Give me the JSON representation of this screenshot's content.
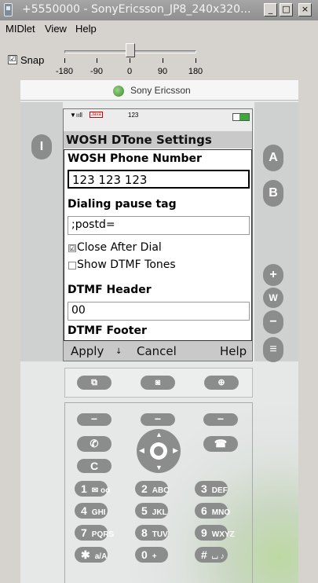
{
  "window": {
    "title": "+5550000 - SonyEricsson_JP8_240x320...",
    "min": "_",
    "max": "□",
    "close": "×"
  },
  "menu": {
    "items": [
      "MIDlet",
      "View",
      "Help"
    ]
  },
  "snap": {
    "label": "Snap",
    "checked": "☑",
    "ticks": [
      "-180",
      "-90",
      "0",
      "90",
      "180"
    ],
    "slider_value": 0
  },
  "phone": {
    "brand": "Sony Ericsson",
    "status": {
      "signal": "▼ııll",
      "java": "Java",
      "number": "123",
      "battery": "▮▮"
    },
    "screen_title": "WOSH DTone Settings",
    "form": {
      "phone_label": "WOSH Phone Number",
      "phone_value": "123 123 123",
      "pause_label": "Dialing pause tag",
      "pause_value": ";postd=",
      "close_label": "Close After Dial",
      "close_checked": "☑",
      "show_label": "Show DTMF Tones",
      "show_checked": "",
      "header_label": "DTMF Header",
      "header_value": "00",
      "footer_label": "DTMF Footer"
    },
    "softkeys": {
      "left": "Apply",
      "middle_icon": "↓",
      "center": "Cancel",
      "right": "Help"
    },
    "side_buttons": {
      "left": "I",
      "a": "A",
      "b": "B",
      "plus": "+",
      "walkman": "W",
      "minus": "−",
      "slider": "≡"
    },
    "keys": [
      {
        "main": "1",
        "sub": "✉ oo"
      },
      {
        "main": "2",
        "sub": "ABC"
      },
      {
        "main": "3",
        "sub": "DEF"
      },
      {
        "main": "4",
        "sub": "GHI"
      },
      {
        "main": "5",
        "sub": "JKL"
      },
      {
        "main": "6",
        "sub": "MNO"
      },
      {
        "main": "7",
        "sub": "PQRS"
      },
      {
        "main": "8",
        "sub": "TUV"
      },
      {
        "main": "9",
        "sub": "WXYZ"
      },
      {
        "main": "✱",
        "sub": "a/A"
      },
      {
        "main": "0",
        "sub": "+"
      },
      {
        "main": "#",
        "sub": "⌴ ♪"
      }
    ],
    "c_key": "C"
  }
}
